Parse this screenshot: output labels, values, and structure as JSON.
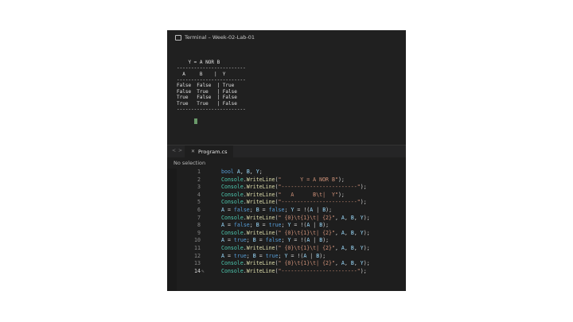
{
  "terminal": {
    "title": "Terminal – Week-02-Lab-01",
    "output": [
      "    Y = A NOR B",
      "------------------------",
      "  A     B    |  Y",
      "------------------------",
      "False  False  | True",
      "False  True   | False",
      "True   False  | False",
      "True   True   | False",
      "------------------------"
    ]
  },
  "editor": {
    "tab_label": "Program.cs",
    "breadcrumb": "No selection",
    "current_line": 14,
    "lines": [
      {
        "num": "1",
        "tokens": [
          {
            "t": "kw",
            "s": "bool"
          },
          {
            "t": "pl",
            "s": " "
          },
          {
            "t": "var",
            "s": "A"
          },
          {
            "t": "pl",
            "s": ", "
          },
          {
            "t": "var",
            "s": "B"
          },
          {
            "t": "pl",
            "s": ", "
          },
          {
            "t": "var",
            "s": "Y"
          },
          {
            "t": "pl",
            "s": ";"
          }
        ]
      },
      {
        "num": "2",
        "tokens": [
          {
            "t": "cls",
            "s": "Console"
          },
          {
            "t": "pl",
            "s": "."
          },
          {
            "t": "mth",
            "s": "WriteLine"
          },
          {
            "t": "pl",
            "s": "("
          },
          {
            "t": "str",
            "s": "\"      Y = A NOR B\""
          },
          {
            "t": "pl",
            "s": ");"
          }
        ]
      },
      {
        "num": "3",
        "tokens": [
          {
            "t": "cls",
            "s": "Console"
          },
          {
            "t": "pl",
            "s": "."
          },
          {
            "t": "mth",
            "s": "WriteLine"
          },
          {
            "t": "pl",
            "s": "("
          },
          {
            "t": "str",
            "s": "\"------------------------\""
          },
          {
            "t": "pl",
            "s": ");"
          }
        ]
      },
      {
        "num": "4",
        "tokens": [
          {
            "t": "cls",
            "s": "Console"
          },
          {
            "t": "pl",
            "s": "."
          },
          {
            "t": "mth",
            "s": "WriteLine"
          },
          {
            "t": "pl",
            "s": "("
          },
          {
            "t": "str",
            "s": "\"   A      B\\t|  Y\""
          },
          {
            "t": "pl",
            "s": ");"
          }
        ]
      },
      {
        "num": "5",
        "tokens": [
          {
            "t": "cls",
            "s": "Console"
          },
          {
            "t": "pl",
            "s": "."
          },
          {
            "t": "mth",
            "s": "WriteLine"
          },
          {
            "t": "pl",
            "s": "("
          },
          {
            "t": "str",
            "s": "\"------------------------\""
          },
          {
            "t": "pl",
            "s": ");"
          }
        ]
      },
      {
        "num": "6",
        "tokens": [
          {
            "t": "var",
            "s": "A"
          },
          {
            "t": "pl",
            "s": " = "
          },
          {
            "t": "kw",
            "s": "false"
          },
          {
            "t": "pl",
            "s": "; "
          },
          {
            "t": "var",
            "s": "B"
          },
          {
            "t": "pl",
            "s": " = "
          },
          {
            "t": "kw",
            "s": "false"
          },
          {
            "t": "pl",
            "s": "; "
          },
          {
            "t": "var",
            "s": "Y"
          },
          {
            "t": "pl",
            "s": " = !("
          },
          {
            "t": "var",
            "s": "A"
          },
          {
            "t": "pl",
            "s": " | "
          },
          {
            "t": "var",
            "s": "B"
          },
          {
            "t": "pl",
            "s": ");"
          }
        ]
      },
      {
        "num": "7",
        "tokens": [
          {
            "t": "cls",
            "s": "Console"
          },
          {
            "t": "pl",
            "s": "."
          },
          {
            "t": "mth",
            "s": "WriteLine"
          },
          {
            "t": "pl",
            "s": "("
          },
          {
            "t": "str",
            "s": "\" {0}\\t{1}\\t| {2}\""
          },
          {
            "t": "pl",
            "s": ", "
          },
          {
            "t": "var",
            "s": "A"
          },
          {
            "t": "pl",
            "s": ", "
          },
          {
            "t": "var",
            "s": "B"
          },
          {
            "t": "pl",
            "s": ", "
          },
          {
            "t": "var",
            "s": "Y"
          },
          {
            "t": "pl",
            "s": ");"
          }
        ]
      },
      {
        "num": "8",
        "tokens": [
          {
            "t": "var",
            "s": "A"
          },
          {
            "t": "pl",
            "s": " = "
          },
          {
            "t": "kw",
            "s": "false"
          },
          {
            "t": "pl",
            "s": "; "
          },
          {
            "t": "var",
            "s": "B"
          },
          {
            "t": "pl",
            "s": " = "
          },
          {
            "t": "kw",
            "s": "true"
          },
          {
            "t": "pl",
            "s": "; "
          },
          {
            "t": "var",
            "s": "Y"
          },
          {
            "t": "pl",
            "s": " = !("
          },
          {
            "t": "var",
            "s": "A"
          },
          {
            "t": "pl",
            "s": " | "
          },
          {
            "t": "var",
            "s": "B"
          },
          {
            "t": "pl",
            "s": ");"
          }
        ]
      },
      {
        "num": "9",
        "tokens": [
          {
            "t": "cls",
            "s": "Console"
          },
          {
            "t": "pl",
            "s": "."
          },
          {
            "t": "mth",
            "s": "WriteLine"
          },
          {
            "t": "pl",
            "s": "("
          },
          {
            "t": "str",
            "s": "\" {0}\\t{1}\\t| {2}\""
          },
          {
            "t": "pl",
            "s": ", "
          },
          {
            "t": "var",
            "s": "A"
          },
          {
            "t": "pl",
            "s": ", "
          },
          {
            "t": "var",
            "s": "B"
          },
          {
            "t": "pl",
            "s": ", "
          },
          {
            "t": "var",
            "s": "Y"
          },
          {
            "t": "pl",
            "s": ");"
          }
        ]
      },
      {
        "num": "10",
        "tokens": [
          {
            "t": "var",
            "s": "A"
          },
          {
            "t": "pl",
            "s": " = "
          },
          {
            "t": "kw",
            "s": "true"
          },
          {
            "t": "pl",
            "s": "; "
          },
          {
            "t": "var",
            "s": "B"
          },
          {
            "t": "pl",
            "s": " = "
          },
          {
            "t": "kw",
            "s": "false"
          },
          {
            "t": "pl",
            "s": "; "
          },
          {
            "t": "var",
            "s": "Y"
          },
          {
            "t": "pl",
            "s": " = !("
          },
          {
            "t": "var",
            "s": "A"
          },
          {
            "t": "pl",
            "s": " | "
          },
          {
            "t": "var",
            "s": "B"
          },
          {
            "t": "pl",
            "s": ");"
          }
        ]
      },
      {
        "num": "11",
        "tokens": [
          {
            "t": "cls",
            "s": "Console"
          },
          {
            "t": "pl",
            "s": "."
          },
          {
            "t": "mth",
            "s": "WriteLine"
          },
          {
            "t": "pl",
            "s": "("
          },
          {
            "t": "str",
            "s": "\" {0}\\t{1}\\t| {2}\""
          },
          {
            "t": "pl",
            "s": ", "
          },
          {
            "t": "var",
            "s": "A"
          },
          {
            "t": "pl",
            "s": ", "
          },
          {
            "t": "var",
            "s": "B"
          },
          {
            "t": "pl",
            "s": ", "
          },
          {
            "t": "var",
            "s": "Y"
          },
          {
            "t": "pl",
            "s": ");"
          }
        ]
      },
      {
        "num": "12",
        "tokens": [
          {
            "t": "var",
            "s": "A"
          },
          {
            "t": "pl",
            "s": " = "
          },
          {
            "t": "kw",
            "s": "true"
          },
          {
            "t": "pl",
            "s": "; "
          },
          {
            "t": "var",
            "s": "B"
          },
          {
            "t": "pl",
            "s": " = "
          },
          {
            "t": "kw",
            "s": "true"
          },
          {
            "t": "pl",
            "s": "; "
          },
          {
            "t": "var",
            "s": "Y"
          },
          {
            "t": "pl",
            "s": " = !("
          },
          {
            "t": "var",
            "s": "A"
          },
          {
            "t": "pl",
            "s": " | "
          },
          {
            "t": "var",
            "s": "B"
          },
          {
            "t": "pl",
            "s": ");"
          }
        ]
      },
      {
        "num": "13",
        "tokens": [
          {
            "t": "cls",
            "s": "Console"
          },
          {
            "t": "pl",
            "s": "."
          },
          {
            "t": "mth",
            "s": "WriteLine"
          },
          {
            "t": "pl",
            "s": "("
          },
          {
            "t": "str",
            "s": "\" {0}\\t{1}\\t| {2}\""
          },
          {
            "t": "pl",
            "s": ", "
          },
          {
            "t": "var",
            "s": "A"
          },
          {
            "t": "pl",
            "s": ", "
          },
          {
            "t": "var",
            "s": "B"
          },
          {
            "t": "pl",
            "s": ", "
          },
          {
            "t": "var",
            "s": "Y"
          },
          {
            "t": "pl",
            "s": ");"
          }
        ]
      },
      {
        "num": "14",
        "tokens": [
          {
            "t": "cls",
            "s": "Console"
          },
          {
            "t": "pl",
            "s": "."
          },
          {
            "t": "mth",
            "s": "WriteLine"
          },
          {
            "t": "pl",
            "s": "("
          },
          {
            "t": "str",
            "s": "\"------------------------\""
          },
          {
            "t": "pl",
            "s": ");"
          }
        ]
      }
    ]
  },
  "icons": {
    "terminal": "terminal-icon",
    "nav_back": "chevron-left-icon",
    "nav_forward": "chevron-right-icon",
    "close_tab": "close-icon",
    "edit": "pencil-icon"
  },
  "colors": {
    "keyword": "#569cd6",
    "class": "#4ec9b0",
    "method": "#dcdcaa",
    "string": "#ce9178",
    "variable": "#9cdcfe"
  }
}
